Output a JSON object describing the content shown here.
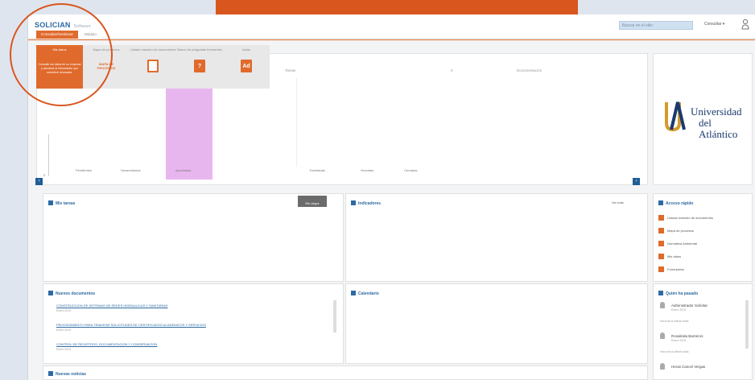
{
  "header": {
    "logo": "SOLICIAN",
    "logo_sub": "Software",
    "search_placeholder": "Buscar en el sitio",
    "user_menu": "Consultar ▾",
    "tabs": [
      "Consultar/Gestionar",
      "Módulo"
    ]
  },
  "quick_menu": {
    "items": [
      {
        "label": "Mis datos",
        "desc": "Consulte los datos de su empresa y actualice la información que considere necesaria."
      },
      {
        "label": "Mapa de procesos",
        "icon_text": "MAPA DE PROCESOS"
      },
      {
        "label": "Listado maestro de documentos",
        "icon_text": ""
      },
      {
        "label": "Banco de preguntas frecuentes",
        "icon_text": "?"
      },
      {
        "label": "Actas",
        "icon_text": "Ad"
      }
    ]
  },
  "charts": {
    "left_labels": [
      "Pendientes",
      "Desarrollados",
      "Aprobados"
    ],
    "mid_title": "Tareas",
    "mid_labels": [
      "Tramitadas",
      "Vencidas",
      "Cerradas"
    ],
    "right_title": "Documentación",
    "right_count": "0",
    "axis_zero": "0"
  },
  "chart_data": {
    "type": "bar",
    "categories": [
      "Pendientes",
      "Desarrollados",
      "Aprobados"
    ],
    "values": [
      0,
      0,
      1
    ],
    "ylim": [
      0,
      1
    ]
  },
  "logo_panel": {
    "line1": "Universidad",
    "line2": "del Atlántico"
  },
  "panels": {
    "my_tasks": {
      "title": "Mis tareas",
      "tab": "Mis cargos"
    },
    "indicators": {
      "title": "Indicadores",
      "link": "Ver más"
    },
    "quick_access": {
      "title": "Acceso rápido",
      "items": [
        "Listado maestro de documentos",
        "Mapa de procesos",
        "Normativa Ambiental",
        "Mis datos",
        "Formularios"
      ]
    },
    "recent_docs": {
      "title": "Nuevos documentos",
      "items": [
        {
          "name": "CONSTRUCCION DE SISTEMAS DE REDES HIDRAULICAS Y SANITARIAS",
          "date": "Enero 2019"
        },
        {
          "name": "PROCEDIMIENTO PARA TRAMITAR SOLICITUDES DE CERTIFICADOS ACADEMICOS Y SERVICIOS",
          "date": "Enero 2019"
        },
        {
          "name": "CONTROL DE REGISTROS, DOCUMENTACION Y CONSERVACION",
          "date": "Enero 2019"
        }
      ]
    },
    "calendar": {
      "title": "Calendario"
    },
    "bottom": {
      "title": "Nuevas noticias"
    },
    "staff": {
      "title": "Quién ha pasado",
      "people": [
        {
          "name": "Administrador Solicitar",
          "date": "Enero 2019",
          "note": "Hora de la última visita"
        },
        {
          "name": "Rosalinda Barreiros",
          "date": "Enero 2019",
          "note": "Hora de la última visita"
        },
        {
          "name": "Hecat Cancel Vergas",
          "date": "",
          "note": ""
        }
      ]
    }
  }
}
